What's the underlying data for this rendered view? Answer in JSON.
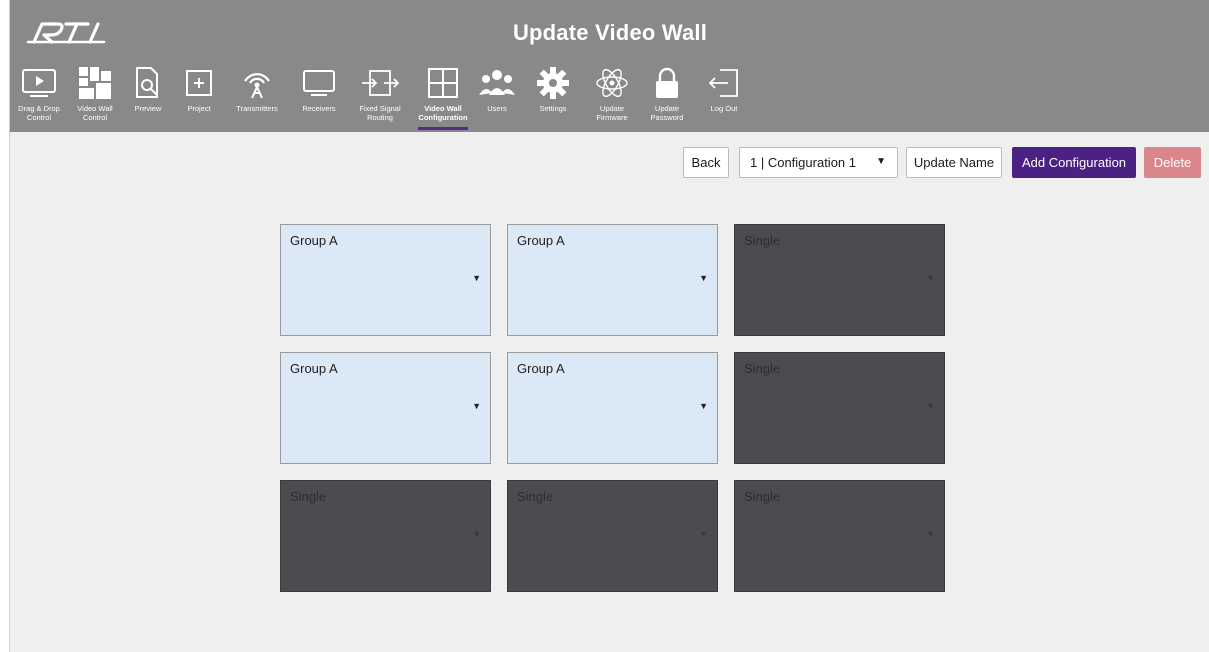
{
  "header": {
    "logo_text": "RTI",
    "title": "Update Video Wall"
  },
  "nav": {
    "items": [
      {
        "label": "Drag & Drop\nControl",
        "icon": "play-monitor-icon"
      },
      {
        "label": "Video Wall\nControl",
        "icon": "video-wall-tiles-icon"
      },
      {
        "label": "Preview",
        "icon": "document-magnifier-icon"
      },
      {
        "label": "Project",
        "icon": "plus-square-icon"
      },
      {
        "label": "Transmitters",
        "icon": "antenna-icon"
      },
      {
        "label": "Receivers",
        "icon": "monitor-icon"
      },
      {
        "label": "Fixed Signal\nRouting",
        "icon": "signal-routing-icon"
      },
      {
        "label": "Video Wall\nConfiguration",
        "icon": "grid-four-icon"
      },
      {
        "label": "Users",
        "icon": "users-icon"
      },
      {
        "label": "Settings",
        "icon": "gear-icon"
      },
      {
        "label": "Update\nFirmware",
        "icon": "atom-icon"
      },
      {
        "label": "Update\nPassword",
        "icon": "lock-icon"
      },
      {
        "label": "Log Out",
        "icon": "logout-icon"
      }
    ],
    "active": "Video Wall Configuration"
  },
  "toolbar": {
    "back_label": "Back",
    "configuration_selected": "1 | Configuration 1",
    "update_name_label": "Update Name",
    "add_configuration_label": "Add Configuration",
    "delete_label": "Delete"
  },
  "wall": {
    "rows": [
      [
        {
          "label": "Group A",
          "type": "group"
        },
        {
          "label": "Group A",
          "type": "group"
        },
        {
          "label": "Single",
          "type": "single"
        }
      ],
      [
        {
          "label": "Group A",
          "type": "group"
        },
        {
          "label": "Group A",
          "type": "group"
        },
        {
          "label": "Single",
          "type": "single"
        }
      ],
      [
        {
          "label": "Single",
          "type": "single"
        },
        {
          "label": "Single",
          "type": "single"
        },
        {
          "label": "Single",
          "type": "single"
        }
      ]
    ],
    "caret": "▼"
  },
  "colors": {
    "header_bg": "#8a888b",
    "accent_purple": "#4b2183",
    "delete_red": "#da8589",
    "group_cell": "#dbe8f6",
    "single_cell": "#4c4b50",
    "page_bg": "#efefef"
  }
}
